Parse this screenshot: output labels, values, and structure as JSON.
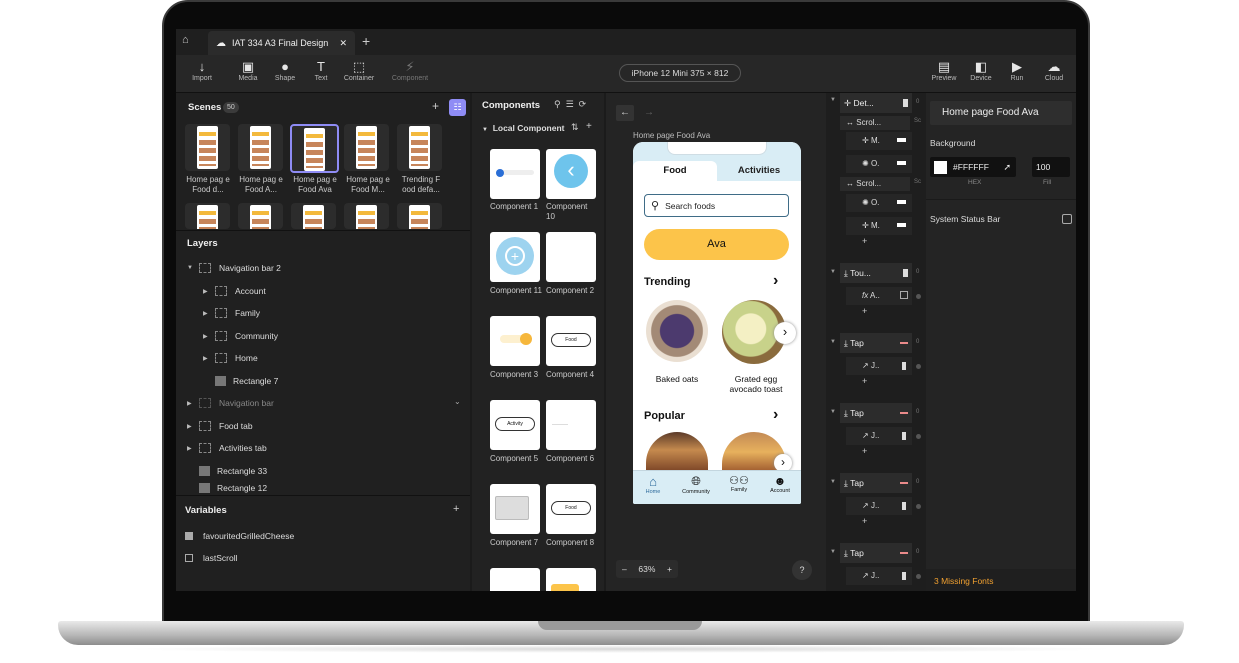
{
  "app": {
    "file_tab": "IAT 334 A3 Final Design",
    "device": "iPhone 12 Mini  375 × 812"
  },
  "toolbar": {
    "import": "Import",
    "media": "Media",
    "shape": "Shape",
    "text": "Text",
    "container": "Container",
    "component": "Component",
    "preview": "Preview",
    "device": "Device",
    "run": "Run",
    "cloud": "Cloud"
  },
  "scenes": {
    "title": "Scenes",
    "count": "50",
    "items": [
      "Home pag e Food d...",
      "Home pag e Food A...",
      "Home pag e Food Ava",
      "Home pag e Food M...",
      "Trending F ood defa..."
    ]
  },
  "layers": {
    "title": "Layers",
    "items": [
      "Navigation bar 2",
      "Account",
      "Family",
      "Community",
      "Home",
      "Rectangle 7",
      "Navigation bar",
      "Food tab",
      "Activities tab",
      "Rectangle 33",
      "Rectangle 12"
    ]
  },
  "variables": {
    "title": "Variables",
    "items": [
      "favouritedGrilledCheese",
      "lastScroll"
    ]
  },
  "components": {
    "title": "Components",
    "local": "Local Component",
    "items": [
      "Component 1",
      "Component 10",
      "Component 11",
      "Component 2",
      "Component 3",
      "Component 4",
      "Component 5",
      "Component 6",
      "Component 7",
      "Component 8"
    ],
    "food_chip": "Food",
    "activity_chip": "Activity"
  },
  "canvas": {
    "scene_name": "Home page Food Ava",
    "zoom": "63%",
    "help": "?"
  },
  "phone": {
    "tab_food": "Food",
    "tab_activities": "Activities",
    "search": "Search foods",
    "ava": "Ava",
    "trending": "Trending",
    "popular": "Popular",
    "item1": "Baked oats",
    "item2": "Grated egg avocado toast",
    "nav": [
      "Home",
      "Community",
      "Family",
      "Account"
    ]
  },
  "nodes": {
    "det": "Det...",
    "scrol": "Scrol...",
    "m": "M.",
    "o": "O.",
    "tou": "Tou...",
    "a": "A..",
    "tap": "Tap",
    "j": "J..",
    "sc": "Sc",
    "zero": "0"
  },
  "props": {
    "title": "Home page Food Ava",
    "background": "Background",
    "hex": "#FFFFFF",
    "fill": "100",
    "hex_label": "HEX",
    "fill_label": "Fill",
    "status_bar": "System Status Bar",
    "missing": "3 Missing Fonts"
  },
  "colors": {
    "accent": "#8f8cf5",
    "ava": "#fcc44a",
    "missing": "#f0a030"
  }
}
